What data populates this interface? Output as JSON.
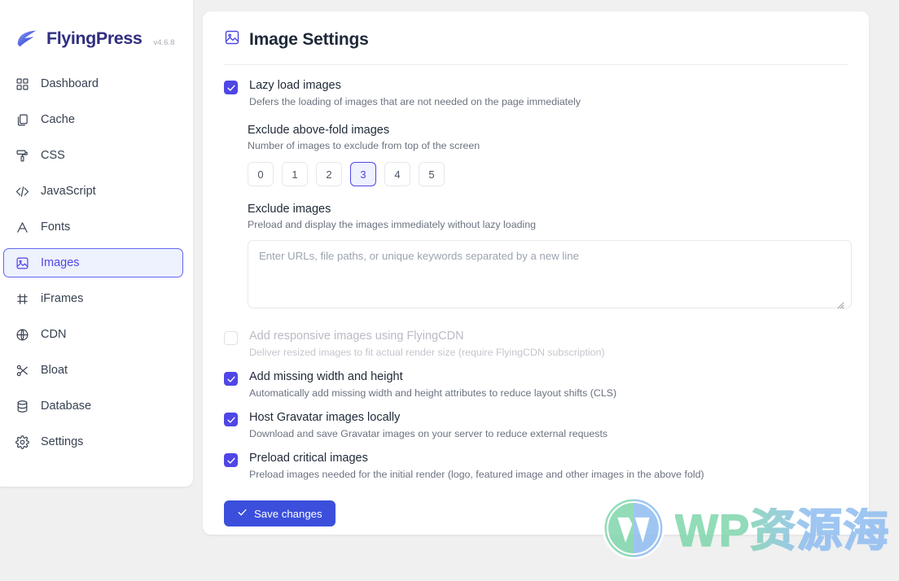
{
  "brand": {
    "name": "FlyingPress",
    "version": "v4.6.8",
    "logo_icon": "flyingpress-logo-icon"
  },
  "sidebar": {
    "items": [
      {
        "label": "Dashboard",
        "icon": "grid-icon",
        "active": false
      },
      {
        "label": "Cache",
        "icon": "copy-icon",
        "active": false
      },
      {
        "label": "CSS",
        "icon": "paint-roller-icon",
        "active": false
      },
      {
        "label": "JavaScript",
        "icon": "code-icon",
        "active": false
      },
      {
        "label": "Fonts",
        "icon": "letter-a-icon",
        "active": false
      },
      {
        "label": "Images",
        "icon": "image-icon",
        "active": true
      },
      {
        "label": "iFrames",
        "icon": "frame-icon",
        "active": false
      },
      {
        "label": "CDN",
        "icon": "globe-icon",
        "active": false
      },
      {
        "label": "Bloat",
        "icon": "scissors-icon",
        "active": false
      },
      {
        "label": "Database",
        "icon": "database-icon",
        "active": false
      },
      {
        "label": "Settings",
        "icon": "gear-icon",
        "active": false
      }
    ]
  },
  "panel": {
    "title": "Image Settings",
    "title_icon": "image-icon",
    "options": {
      "lazy_load": {
        "title": "Lazy load images",
        "desc": "Defers the loading of images that are not needed on the page immediately",
        "checked": true
      },
      "responsive_cdn": {
        "title": "Add responsive images using FlyingCDN",
        "desc": "Deliver resized images to fit actual render size (require FlyingCDN subscription)",
        "checked": false,
        "disabled": true
      },
      "width_height": {
        "title": "Add missing width and height",
        "desc": "Automatically add missing width and height attributes to reduce layout shifts (CLS)",
        "checked": true
      },
      "gravatar": {
        "title": "Host Gravatar images locally",
        "desc": "Download and save Gravatar images on your server to reduce external requests",
        "checked": true
      },
      "preload_critical": {
        "title": "Preload critical images",
        "desc": "Preload images needed for the initial render (logo, featured image and other images in the above fold)",
        "checked": true
      }
    },
    "above_fold": {
      "title": "Exclude above-fold images",
      "desc": "Number of images to exclude from top of the screen",
      "choices": [
        "0",
        "1",
        "2",
        "3",
        "4",
        "5"
      ],
      "selected": "3"
    },
    "exclude_images": {
      "title": "Exclude images",
      "desc": "Preload and display the images immediately without lazy loading",
      "placeholder": "Enter URLs, file paths, or unique keywords separated by a new line",
      "value": ""
    },
    "save_label": "Save changes",
    "save_icon": "check-icon"
  },
  "watermark": {
    "text": "WP资源海",
    "logo_icon": "wordpress-logo-icon"
  },
  "colors": {
    "accent": "#4f46e5",
    "accent_soft": "#eef1fe",
    "save_button": "#3b4fdc",
    "page_bg": "#f0f0f0"
  }
}
